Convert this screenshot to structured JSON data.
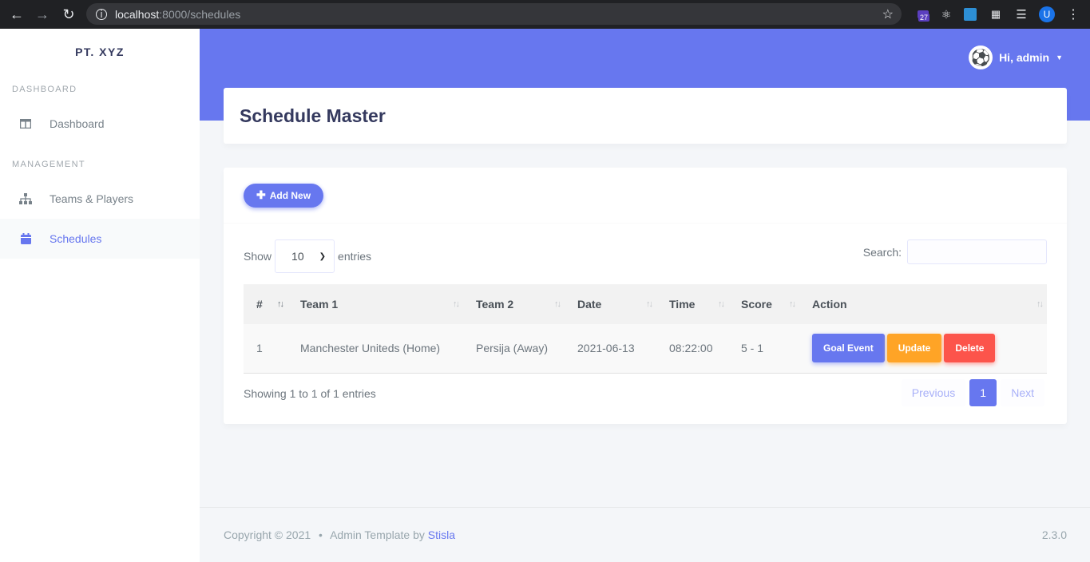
{
  "browser": {
    "url_host": "localhost",
    "url_path": ":8000/schedules",
    "ext_badge": "27",
    "profile_initial": "U"
  },
  "sidebar": {
    "brand": "PT. XYZ",
    "sections": [
      {
        "header": "DASHBOARD",
        "items": [
          {
            "label": "Dashboard",
            "icon": "columns-icon"
          }
        ]
      },
      {
        "header": "MANAGEMENT",
        "items": [
          {
            "label": "Teams & Players",
            "icon": "sitemap-icon"
          },
          {
            "label": "Schedules",
            "icon": "calendar-icon",
            "active": true
          }
        ]
      }
    ]
  },
  "topbar": {
    "user_greeting": "Hi, admin"
  },
  "page": {
    "title": "Schedule Master"
  },
  "card": {
    "add_label": "Add New",
    "show_label": "Show",
    "entries_label": "entries",
    "page_length": "10",
    "search_label": "Search:",
    "search_value": "",
    "columns": [
      "#",
      "Team 1",
      "Team 2",
      "Date",
      "Time",
      "Score",
      "Action"
    ],
    "rows": [
      {
        "no": "1",
        "team1": "Manchester Uniteds (Home)",
        "team2": "Persija (Away)",
        "date": "2021-06-13",
        "time": "08:22:00",
        "score": "5 - 1"
      }
    ],
    "actions": {
      "goal": "Goal Event",
      "update": "Update",
      "delete": "Delete"
    },
    "info": "Showing 1 to 1 of 1 entries",
    "pagination": {
      "previous": "Previous",
      "current": "1",
      "next": "Next"
    }
  },
  "footer": {
    "copyright": "Copyright © 2021",
    "bullet": "•",
    "template_text": "Admin Template by",
    "template_link": "Stisla",
    "version": "2.3.0"
  },
  "colors": {
    "primary": "#6777ef",
    "warning": "#ffa426",
    "danger": "#fc544b"
  }
}
